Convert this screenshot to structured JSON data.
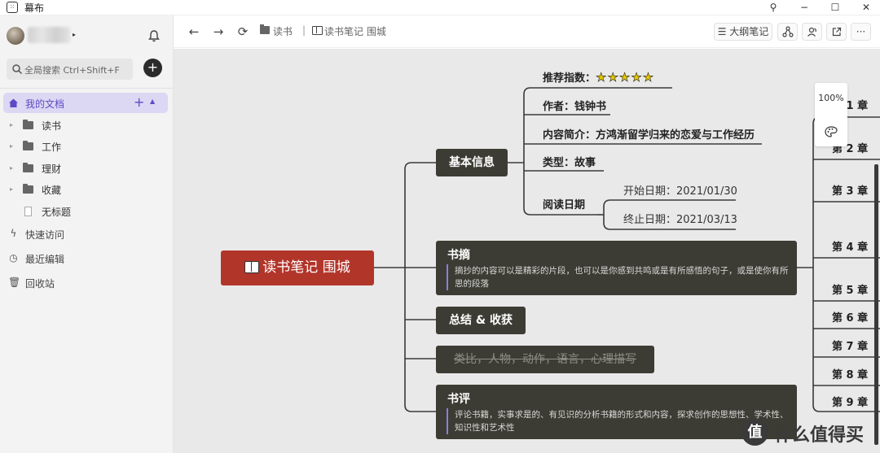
{
  "window": {
    "title": "幕布",
    "logo_glyph": "⁙"
  },
  "titlebar_buttons": {
    "pin": "⚲",
    "minimize": "−",
    "maximize": "☐",
    "close": "✕"
  },
  "sidebar": {
    "search_placeholder": "全局搜索 Ctrl+Shift+F",
    "add_label": "+",
    "my_docs": "我的文档",
    "my_docs_add": "+",
    "my_docs_collapse": "▲",
    "folders": [
      {
        "label": "读书",
        "type": "folder"
      },
      {
        "label": "工作",
        "type": "folder"
      },
      {
        "label": "理财",
        "type": "folder"
      },
      {
        "label": "收藏",
        "type": "folder"
      },
      {
        "label": "无标题",
        "type": "doc"
      }
    ],
    "nav": [
      {
        "label": "快速访问",
        "icon": "lightning-icon",
        "glyph": "ϟ"
      },
      {
        "label": "最近编辑",
        "icon": "clock-icon",
        "glyph": "◷"
      },
      {
        "label": "回收站",
        "icon": "trash-icon",
        "glyph": "🗑"
      }
    ]
  },
  "toolbar": {
    "back": "←",
    "forward": "→",
    "refresh": "⟳",
    "breadcrumb_folder": "读书",
    "breadcrumb_sep": "|",
    "breadcrumb_doc": "读书笔记 围城",
    "outline_btn": "大纲笔记",
    "outline_icon": "☰",
    "more": "···"
  },
  "mindmap": {
    "root": "读书笔记 围城",
    "basic_info": {
      "title": "基本信息",
      "rating_label": "推荐指数：",
      "rating_stars": 5,
      "stars_text": "★★★★★",
      "author": "作者：钱钟书",
      "summary": "内容简介：方鸿渐留学归来的恋爱与工作经历",
      "genre": "类型：故事",
      "read_date": "阅读日期",
      "start_date": "开始日期：2021/01/30",
      "end_date": "终止日期：2021/03/13"
    },
    "excerpts": {
      "title": "书摘",
      "note": "摘抄的内容可以是精彩的片段，也可以是你感到共鸣或是有所感悟的句子，或是使你有所思的段落"
    },
    "summary_node": "总结 & 收获",
    "struck_node": "类比，人物，动作，语言，心理描写",
    "review": {
      "title": "书评",
      "note": "评论书籍，实事求是的、有见识的分析书籍的形式和内容，探求创作的思想性、学术性、知识性和艺术性"
    },
    "chapters": [
      "第 1 章",
      "第 2 章",
      "第 3 章",
      "第 4 章",
      "第 5 章",
      "第 6 章",
      "第 7 章",
      "第 8 章",
      "第 9 章"
    ]
  },
  "zoom": {
    "level": "100%"
  },
  "watermark": {
    "glyph": "值",
    "text": "什么值得买"
  },
  "colors": {
    "root": "#b2352a",
    "node": "#3c3c34",
    "accent": "#5b4bc4",
    "canvas": "#e9e9e9"
  }
}
